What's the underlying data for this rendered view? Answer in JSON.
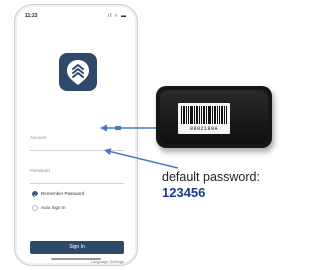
{
  "status_bar": {
    "time": "11:23",
    "icons": [
      "signal-icon",
      "wifi-icon",
      "battery-icon"
    ],
    "icon_glyphs": "ıl ≈ ▬"
  },
  "login": {
    "account_label": "Account",
    "password_label": "Password",
    "remember_password": {
      "label": "Remember Password",
      "checked": true
    },
    "auto_sign_in": {
      "label": "Auto Sign In",
      "checked": false
    },
    "sign_in_label": "Sign In",
    "language_settings": "Language Settings"
  },
  "device": {
    "serial": "8902180A"
  },
  "callout": {
    "default_password_label": "default password:",
    "default_password_value": "123456"
  },
  "colors": {
    "brand": "#2e4a6b",
    "arrow": "#4a78c4",
    "value_text": "#1f3a8a"
  }
}
